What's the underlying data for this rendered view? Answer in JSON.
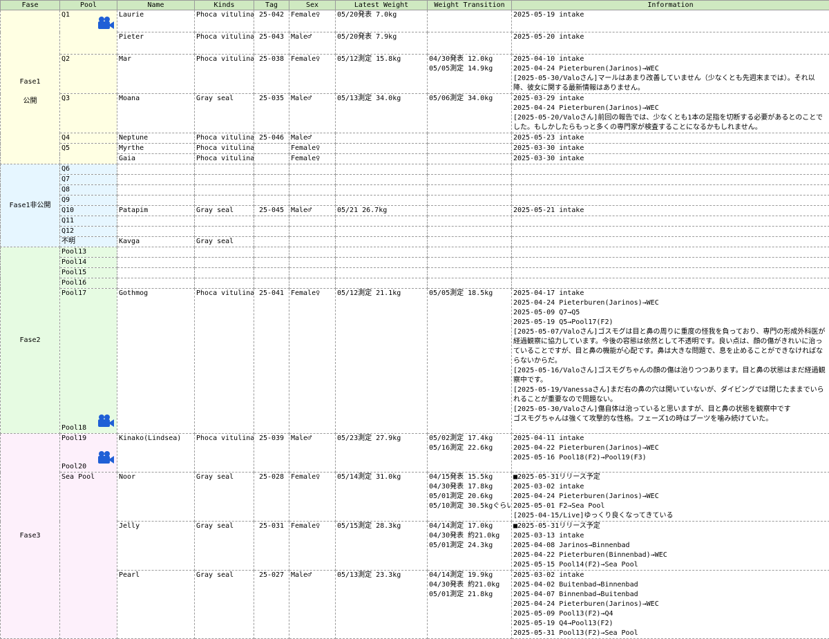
{
  "columns": [
    "Fase",
    "Pool",
    "Name",
    "Kinds",
    "Tag",
    "Sex",
    "Latest Weight",
    "Weight Transition",
    "Information"
  ],
  "colors": {
    "header_bg": "#cfe9c1",
    "fase1": "#ffffe3",
    "fase1_private": "#e6f6ff",
    "fase2": "#e6fbe2",
    "fase3": "#fdf0fb",
    "camera_icon": "#1f5fd6"
  },
  "groups": {
    "fase1": {
      "label": "Fase1\n公開"
    },
    "fase1_private": {
      "label": "Fase1非公開"
    },
    "fase2": {
      "label": "Fase2"
    },
    "fase3": {
      "label": "Fase3"
    }
  },
  "rows": {
    "q1a": {
      "pool": "Q1",
      "name": "Laurie",
      "kinds": "Phoca vitulina",
      "tag": "25-042",
      "sex": "Female♀",
      "latest": "05/20発表 7.0kg",
      "transition": [],
      "info": [
        "2025-05-19 intake"
      ]
    },
    "q1b": {
      "pool": "",
      "name": "Pieter",
      "kinds": "Phoca vitulina",
      "tag": "25-043",
      "sex": "Male♂",
      "latest": "05/20発表 7.9kg",
      "transition": [],
      "info": [
        "2025-05-20 intake"
      ]
    },
    "q2": {
      "pool": "Q2",
      "name": "Mar",
      "kinds": "Phoca vitulina",
      "tag": "25-038",
      "sex": "Female♀",
      "latest": "05/12測定 15.8kg",
      "transition": [
        "04/30発表 12.0kg",
        "05/05測定 14.9kg"
      ],
      "info": [
        "2025-04-10 intake",
        "2025-04-24 Pieterburen(Jarinos)→WEC",
        "[2025-05-30/Valoさん]マールはあまり改善していません（少なくとも先週末までは）。それ以降、彼女に関する最新情報はありません。"
      ]
    },
    "q3": {
      "pool": "Q3",
      "name": "Moana",
      "kinds": "Gray seal",
      "tag": "25-035",
      "sex": "Male♂",
      "latest": "05/13測定 34.0kg",
      "transition": [
        "05/06測定 34.0kg"
      ],
      "info": [
        "2025-03-29 intake",
        "2025-04-24 Pieterburen(Jarinos)→WEC",
        "[2025-05-20/Valoさん]前回の報告では、少なくとも1本の足指を切断する必要があるとのことでした。もしかしたらもっと多くの専門家が検査することになるかもしれません。"
      ]
    },
    "q4": {
      "pool": "Q4",
      "name": "Neptune",
      "kinds": "Phoca vitulina",
      "tag": "25-046",
      "sex": "Male♂",
      "latest": "",
      "transition": [],
      "info": [
        "2025-05-23 intake"
      ]
    },
    "q5a": {
      "pool": "Q5",
      "name": "Myrthe",
      "kinds": "Phoca vitulina",
      "tag": "",
      "sex": "Female♀",
      "latest": "",
      "transition": [],
      "info": [
        "2025-03-30 intake"
      ]
    },
    "q5b": {
      "pool": "",
      "name": "Gaia",
      "kinds": "Phoca vitulina",
      "tag": "",
      "sex": "Female♀",
      "latest": "",
      "transition": [],
      "info": [
        "2025-03-30 intake"
      ]
    },
    "q6": {
      "pool": "Q6"
    },
    "q7": {
      "pool": "Q7"
    },
    "q8": {
      "pool": "Q8"
    },
    "q9": {
      "pool": "Q9"
    },
    "q10": {
      "pool": "Q10",
      "name": "Patapim",
      "kinds": "Gray seal",
      "tag": "25-045",
      "sex": "Male♂",
      "latest": "05/21 26.7kg",
      "info": [
        "2025-05-21 intake"
      ]
    },
    "q11": {
      "pool": "Q11"
    },
    "q12": {
      "pool": "Q12"
    },
    "unknown": {
      "pool": "不明",
      "name": "Kavga",
      "kinds": "Gray seal"
    },
    "p13": {
      "pool": "Pool13"
    },
    "p14": {
      "pool": "Pool14"
    },
    "p15": {
      "pool": "Pool15"
    },
    "p16": {
      "pool": "Pool16"
    },
    "p17": {
      "pool": "Pool17",
      "pool_bottom": "Pool18",
      "name": "Gothmog",
      "kinds": "Phoca vitulina",
      "tag": "25-041",
      "sex": "Female♀",
      "latest": "05/12測定 21.1kg",
      "transition": [
        "05/05測定 18.5kg"
      ],
      "info": [
        "2025-04-17 intake",
        "2025-04-24 Pieterburen(Jarinos)→WEC",
        "2025-05-09 Q7→Q5",
        "2025-05-19 Q5→Pool17(F2)",
        "[2025-05-07/Valoさん]ゴスモグは目と鼻の周りに重度の怪我を負っており、専門の形成外科医が経過観察に協力しています。今後の容態は依然として不透明です。良い点は、顔の傷がきれいに治っていることですが、目と鼻の機能が心配です。鼻は大きな問題で、息を止めることができなければならないからだ。",
        "[2025-05-16/Valoさん]ゴスモグちゃんの顔の傷は治りつつあります。目と鼻の状態はまだ経過観察中です。",
        "[2025-05-19/Vanessaさん]まだ右の鼻の穴は開いていないが、ダイビングでは閉じたままでいられることが重要なので問題ない。",
        "[2025-05-30/Valoさん]傷自体は治っていると思いますが、目と鼻の状態を観察中です",
        "ゴスモグちゃんは強くて攻撃的な性格。フェーズ1の時はブーツを噛み続けていた。"
      ]
    },
    "p19": {
      "pool": "Pool19",
      "pool_bottom": "Pool20",
      "name": "Kinako(Lindsea)",
      "kinds": "Phoca vitulina",
      "tag": "25-039",
      "sex": "Male♂",
      "latest": "05/23測定 27.9kg",
      "transition": [
        "05/02測定 17.4kg",
        "05/16測定 22.6kg"
      ],
      "info": [
        "2025-04-11 intake",
        "2025-04-22 Pieterburen(Jarinos)→WEC",
        "2025-05-16 Pool18(F2)→Pool19(F3)"
      ]
    },
    "sea1": {
      "pool": "Sea Pool",
      "name": "Noor",
      "kinds": "Gray seal",
      "tag": "25-028",
      "sex": "Female♀",
      "latest": "05/14測定 31.0kg",
      "transition": [
        "04/15発表 15.5kg",
        "04/30発表 17.8kg",
        "05/01測定 20.6kg",
        "05/10測定 30.5kgぐらい"
      ],
      "info": [
        "■2025-05-31リリース予定",
        "2025-03-02 intake",
        "2025-04-24 Pieterburen(Jarinos)→WEC",
        "2025-05-01 F2→Sea Pool",
        "[2025-04-15/Live]ゆっくり良くなってきている"
      ]
    },
    "sea2": {
      "pool": "",
      "name": "Jelly",
      "kinds": "Gray seal",
      "tag": "25-031",
      "sex": "Female♀",
      "latest": "05/15測定 28.3kg",
      "transition": [
        "04/14測定 17.0kg",
        "04/30発表 約21.0kg",
        "05/01測定 24.3kg"
      ],
      "info": [
        "■2025-05-31リリース予定",
        "2025-03-13 intake",
        "2025-04-08 Jarinos→Binnenbad",
        "2025-04-22 Pieterburen(Binnenbad)→WEC",
        "2025-05-15 Pool14(F2)→Sea Pool"
      ]
    },
    "sea3": {
      "pool": "",
      "name": "Pearl",
      "kinds": "Gray seal",
      "tag": "25-027",
      "sex": "Male♂",
      "latest": "05/13測定 23.3kg",
      "transition": [
        "04/14測定 19.9kg",
        "04/30発表 約21.0kg",
        "05/01測定 21.8kg"
      ],
      "info": [
        "2025-03-02 intake",
        "2025-04-02 Buitenbad→Binnenbad",
        "2025-04-07 Binnenbad→Buitenbad",
        "2025-04-24 Pieterburen(Jarinos)→WEC",
        "2025-05-09 Pool13(F2)→Q4",
        "2025-05-19 Q4→Pool13(F2)",
        "2025-05-31 Pool13(F2)→Sea Pool"
      ]
    }
  }
}
